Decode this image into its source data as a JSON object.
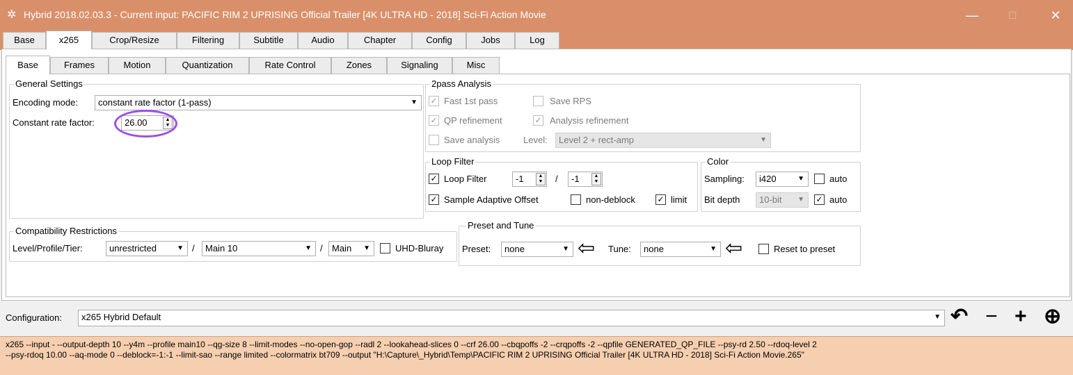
{
  "window": {
    "title": "Hybrid 2018.02.03.3 - Current input: PACIFIC RIM 2  UPRISING Official Trailer [4K ULTRA HD - 2018] Sci-Fi Action Movie",
    "minimize": "—",
    "maximize": "☐",
    "close": "✕"
  },
  "main_tabs": [
    "Base",
    "x265",
    "Crop/Resize",
    "Filtering",
    "Subtitle",
    "Audio",
    "Chapter",
    "Config",
    "Jobs",
    "Log"
  ],
  "main_tab_active": "x265",
  "sub_tabs": [
    "Base",
    "Frames",
    "Motion",
    "Quantization",
    "Rate Control",
    "Zones",
    "Signaling",
    "Misc"
  ],
  "sub_tab_active": "Base",
  "general": {
    "title": "General Settings",
    "encoding_mode_label": "Encoding mode:",
    "encoding_mode_value": "constant rate factor (1-pass)",
    "crf_label": "Constant rate factor:",
    "crf_value": "26.00"
  },
  "twopass": {
    "title": "2pass Analysis",
    "fast_first_pass": "Fast 1st pass",
    "save_rps": "Save RPS",
    "qp_refinement": "QP refinement",
    "analysis_refinement": "Analysis refinement",
    "save_analysis": "Save analysis",
    "level_label": "Level:",
    "level_value": "Level 2 + rect-amp"
  },
  "loop_filter": {
    "title": "Loop Filter",
    "loop_filter_label": "Loop Filter",
    "value1": "-1",
    "separator": "/",
    "value2": "-1",
    "sao_label": "Sample Adaptive Offset",
    "non_deblock_label": "non-deblock",
    "limit_label": "limit"
  },
  "color": {
    "title": "Color",
    "sampling_label": "Sampling:",
    "sampling_value": "i420",
    "auto1": "auto",
    "bitdepth_label": "Bit depth",
    "bitdepth_value": "10-bit",
    "auto2": "auto"
  },
  "compat": {
    "title": "Compatibility Restrictions",
    "label": "Level/Profile/Tier:",
    "level_value": "unrestricted",
    "sep1": "/",
    "profile_value": "Main 10",
    "sep2": "/",
    "tier_value": "Main",
    "uhd_label": "UHD-Bluray"
  },
  "preset_tune": {
    "title": "Preset and Tune",
    "preset_label": "Preset:",
    "preset_value": "none",
    "tune_label": "Tune:",
    "tune_value": "none",
    "reset_label": "Reset to preset"
  },
  "config": {
    "label": "Configuration:",
    "value": "x265 Hybrid Default"
  },
  "cmdline": {
    "line1": "x265 --input - --output-depth 10 --y4m --profile main10 --qg-size 8 --limit-modes --no-open-gop --radl 2 --lookahead-slices 0 --crf 26.00 --cbqpoffs -2 --crqpoffs -2 --qpfile GENERATED_QP_FILE --psy-rd 2.50 --rdoq-level 2",
    "line2": "--psy-rdoq 10.00 --aq-mode 0 --deblock=-1:-1 --limit-sao --range limited --colormatrix bt709 --output \"H:\\Capture\\_Hybrid\\Temp\\PACIFIC RIM 2  UPRISING Official Trailer [4K ULTRA HD - 2018] Sci-Fi Action Movie.265\""
  },
  "checks": {
    "check_mark": "✓"
  },
  "colors": {
    "titlebar": "#d9906a",
    "cmdline_bg": "#f5cfb0",
    "highlight_circle": "#9b4fe8"
  },
  "icons": [
    "app-icon",
    "minimize-icon",
    "maximize-icon",
    "close-icon",
    "dropdown-arrow-icon",
    "spin-arrows-icon",
    "left-arrow-icon",
    "undo-icon",
    "minus-icon",
    "plus-icon",
    "save-config-icon"
  ]
}
